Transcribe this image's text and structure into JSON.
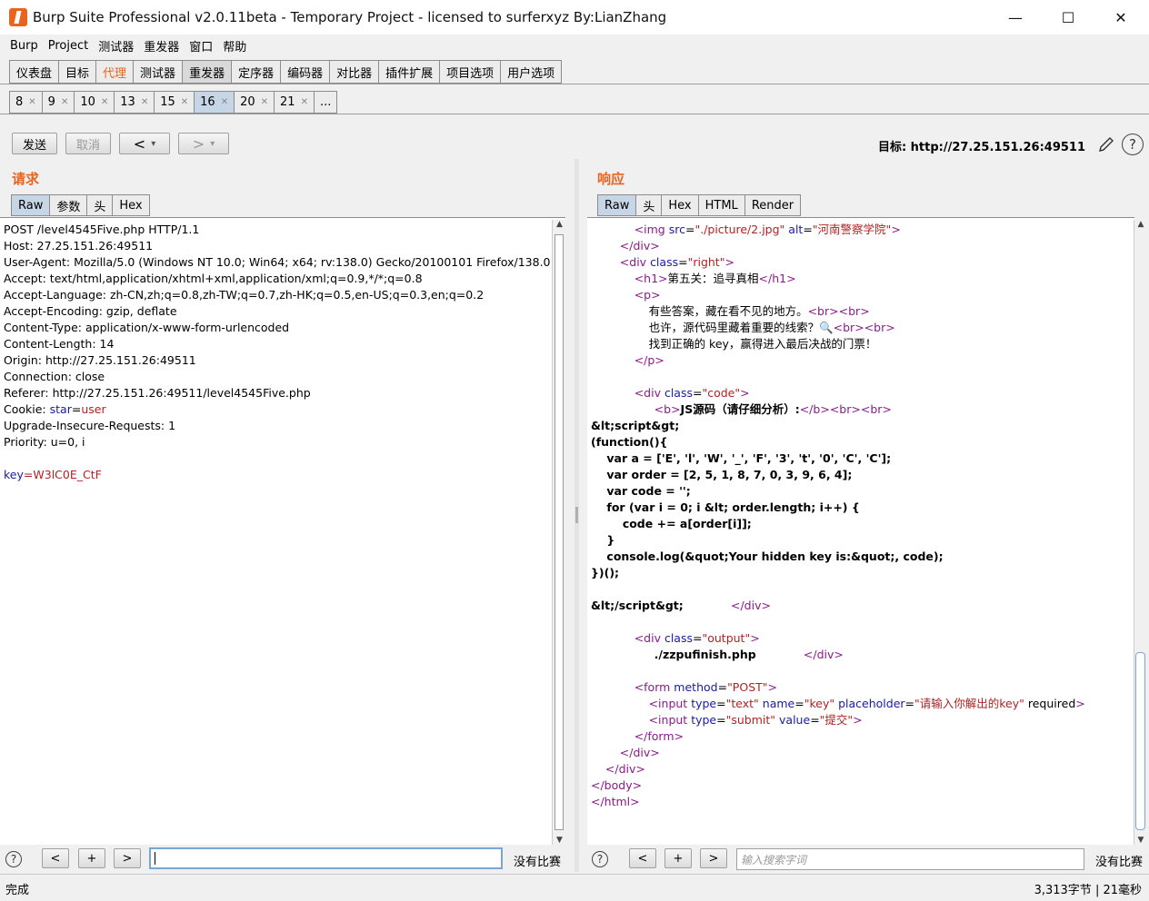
{
  "window": {
    "title": "Burp Suite Professional v2.0.11beta - Temporary Project - licensed to surferxyz By:LianZhang",
    "minimize": "—",
    "maximize": "☐",
    "close": "✕"
  },
  "menu": [
    "Burp",
    "Project",
    "测试器",
    "重发器",
    "窗口",
    "帮助"
  ],
  "main_tabs": [
    "仪表盘",
    "目标",
    "代理",
    "测试器",
    "重发器",
    "定序器",
    "编码器",
    "对比器",
    "插件扩展",
    "项目选项",
    "用户选项"
  ],
  "sub_tabs": [
    "8",
    "9",
    "10",
    "13",
    "15",
    "16",
    "20",
    "21",
    "..."
  ],
  "toolbar": {
    "send": "发送",
    "cancel": "取消",
    "back": "<",
    "forward": ">",
    "dropdown": "▾",
    "target": "目标: http://27.25.151.26:49511"
  },
  "request": {
    "title": "请求",
    "tabs": [
      "Raw",
      "参数",
      "头",
      "Hex"
    ],
    "lines": [
      "POST /level4545Five.php HTTP/1.1",
      "Host: 27.25.151.26:49511",
      "User-Agent: Mozilla/5.0 (Windows NT 10.0; Win64; x64; rv:138.0) Gecko/20100101 Firefox/138.0",
      "Accept: text/html,application/xhtml+xml,application/xml;q=0.9,*/*;q=0.8",
      "Accept-Language: zh-CN,zh;q=0.8,zh-TW;q=0.7,zh-HK;q=0.5,en-US;q=0.3,en;q=0.2",
      "Accept-Encoding: gzip, deflate",
      "Content-Type: application/x-www-form-urlencoded",
      "Content-Length: 14",
      "Origin: http://27.25.151.26:49511",
      "Connection: close",
      "Referer: http://27.25.151.26:49511/level4545Five.php",
      "Cookie: star=user",
      "Upgrade-Insecure-Requests: 1",
      "Priority: u=0, i",
      "",
      "key=W3lC0E_CtF"
    ],
    "search_placeholder": "",
    "no_match": "没有比赛"
  },
  "response": {
    "title": "响应",
    "tabs": [
      "Raw",
      "头",
      "Hex",
      "HTML",
      "Render"
    ],
    "lines": [
      "            <img src=\"./picture/2.jpg\" alt=\"河南警察学院\">",
      "        </div>",
      "        <div class=\"right\">",
      "            <h1>第五关：追寻真相</h1>",
      "            <p>",
      "                有些答案，藏在看不见的地方。<br><br>",
      "                也许，源代码里藏着重要的线索？🔍<br><br>",
      "                找到正确的 key，赢得进入最后决战的门票！",
      "            </p>",
      "",
      "            <div class=\"code\">",
      "                <b>JS源码（请仔细分析）:</b><br><br>",
      "&lt;script&gt;",
      "(function(){",
      "    var a = ['E', 'l', 'W', '_', 'F', '3', 't', '0', 'C', 'C'];",
      "    var order = [2, 5, 1, 8, 7, 0, 3, 9, 6, 4];",
      "    var code = '';",
      "    for (var i = 0; i &lt; order.length; i++) {",
      "        code += a[order[i]];",
      "    }",
      "    console.log(&quot;Your hidden key is:&quot;, code);",
      "})();",
      "",
      "&lt;/script&gt;            </div>",
      "",
      "            <div class=\"output\">",
      "                ./zzpufinish.php            </div>",
      "",
      "            <form method=\"POST\">",
      "                <input type=\"text\" name=\"key\" placeholder=\"请输入你解出的key\" required>",
      "                <input type=\"submit\" value=\"提交\">",
      "            </form>",
      "        </div>",
      "    </div>",
      "</body>",
      "</html>"
    ],
    "search_placeholder": "输入搜索字词",
    "no_match": "没有比赛"
  },
  "bottom_buttons": [
    "<",
    "+",
    ">"
  ],
  "status": {
    "left": "完成",
    "right": "3,313字节 | 21毫秒"
  },
  "colors": {
    "accent": "#e8641f",
    "active_tab": "#c7d6e6",
    "tag": "#8b1a8b",
    "attr": "#1a1aa6",
    "value": "#b22222"
  }
}
